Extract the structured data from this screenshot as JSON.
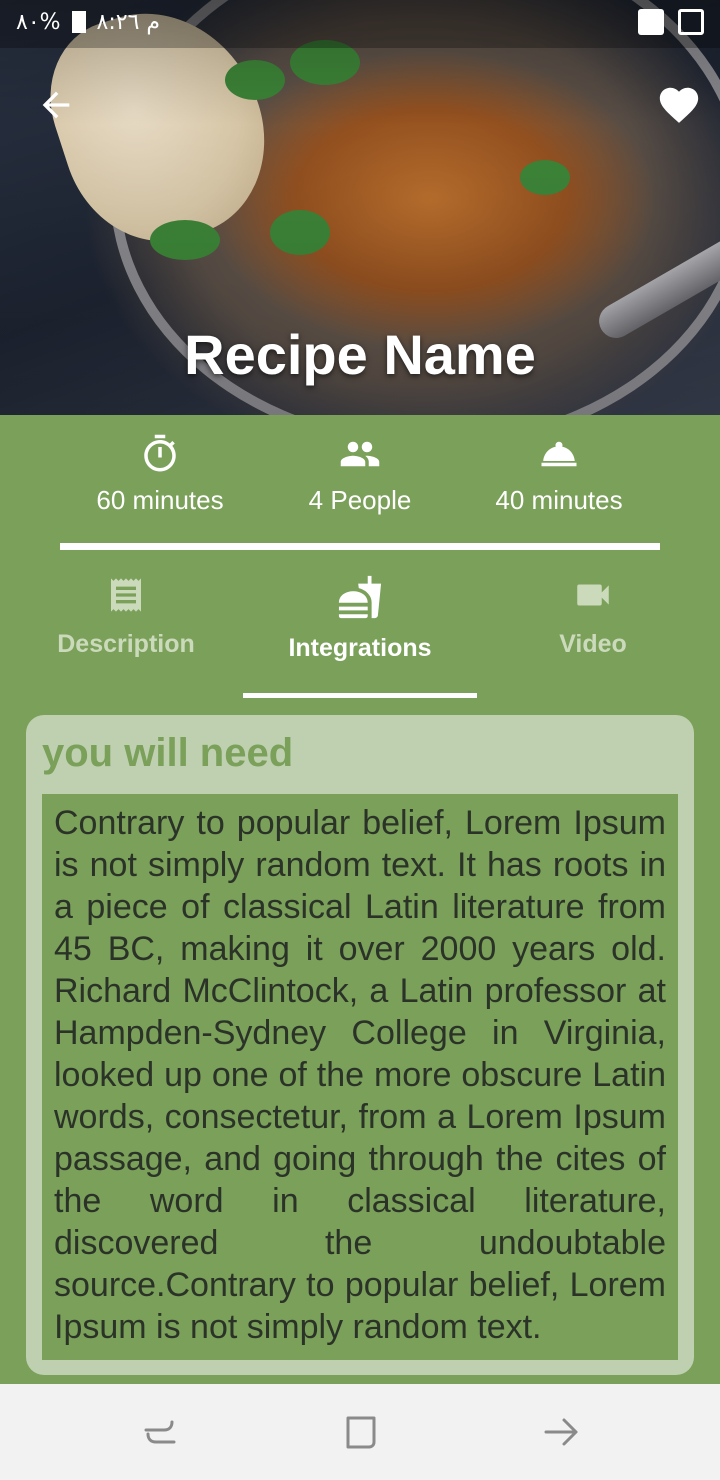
{
  "status_bar": {
    "time": "م ٨:٢٦",
    "battery": "%٨٠"
  },
  "hero": {
    "title": "Recipe Name",
    "back_icon": "arrow-left-icon",
    "favorite_icon": "heart-icon"
  },
  "stats": [
    {
      "icon": "timer-icon",
      "label": "60 minutes"
    },
    {
      "icon": "people-icon",
      "label": "4 People"
    },
    {
      "icon": "room-service-icon",
      "label": "40 minutes"
    }
  ],
  "tabs": [
    {
      "icon": "receipt-icon",
      "label": "Description",
      "active": false
    },
    {
      "icon": "fastfood-icon",
      "label": "Integrations",
      "active": true
    },
    {
      "icon": "videocam-icon",
      "label": "Video",
      "active": false
    }
  ],
  "card": {
    "title": "you will need",
    "body": "Contrary to popular belief, Lorem Ipsum is not simply random text. It has roots in a piece of classical Latin literature from 45 BC, making it over 2000 years old. Richard McClintock, a Latin professor at Hampden-Sydney College in Virginia, looked up one of the more obscure Latin words, consectetur, from a Lorem Ipsum passage, and going through the cites of the word in classical literature, discovered the undoubtable source.Contrary to popular belief, Lorem Ipsum is not simply random text."
  },
  "colors": {
    "primary_green": "#7aa05a",
    "card_light_green": "#bed0b0",
    "inactive_tab": "#cbdabb"
  }
}
